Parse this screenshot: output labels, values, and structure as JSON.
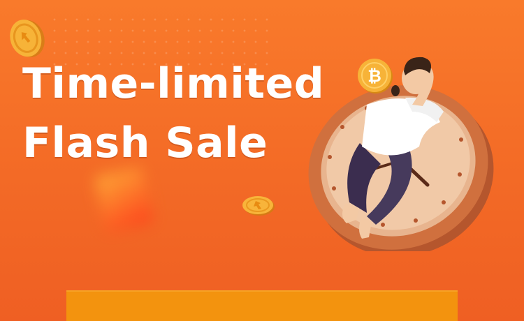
{
  "banner": {
    "title_line1": "Time-limited",
    "title_line2": "Flash Sale"
  },
  "colors": {
    "background_start": "#f97a2b",
    "background_end": "#ef5f23",
    "bottom_bar": "#f3930e",
    "coin": "#f5a623",
    "clock_rim": "#c8653a"
  },
  "icons": {
    "top_left_coin": "coin-icon",
    "middle_coin": "coin-icon",
    "bitcoin_coin": "bitcoin-icon",
    "clock": "clock-icon"
  }
}
